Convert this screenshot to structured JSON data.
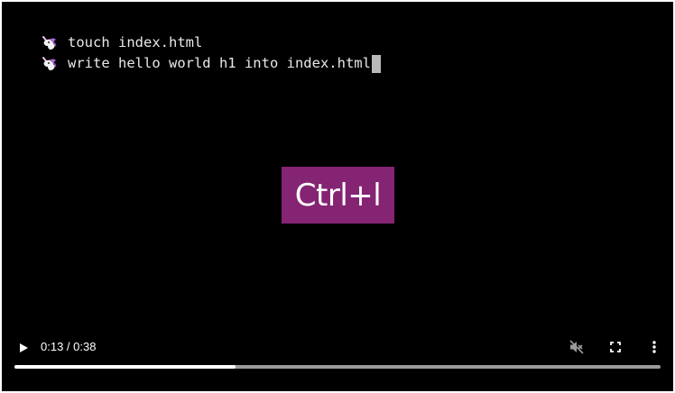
{
  "terminal": {
    "prompt_icon": "unicorn-icon",
    "lines": [
      "touch index.html",
      "write hello world h1 into index.html"
    ]
  },
  "keycast": {
    "label": "Ctrl+l",
    "color": "#842473"
  },
  "player": {
    "current_time": "0:13",
    "duration": "0:38",
    "time_display": "0:13 / 0:38",
    "progress_fraction": 0.342,
    "icons": {
      "play": "play-icon",
      "mute": "volume-muted-icon",
      "fullscreen": "fullscreen-icon",
      "more": "more-vertical-icon"
    }
  }
}
